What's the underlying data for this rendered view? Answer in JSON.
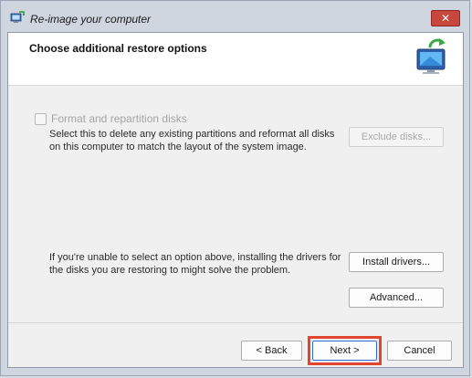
{
  "window": {
    "title": "Re-image your computer",
    "close_label": "✕"
  },
  "header": {
    "title": "Choose additional restore options",
    "icon": "computer-restore-icon"
  },
  "options": {
    "format_checkbox_label": "Format and repartition disks",
    "format_checked": false,
    "format_description": "Select this to delete any existing partitions and reformat all disks on this computer to match the layout of the system image.",
    "exclude_button": "Exclude disks...",
    "driver_description": "If you're unable to select an option above, installing the drivers for the disks you are restoring to might solve the problem.",
    "install_button": "Install drivers...",
    "advanced_button": "Advanced..."
  },
  "footer": {
    "back_button": "< Back",
    "next_button": "Next >",
    "cancel_button": "Cancel"
  },
  "colors": {
    "close_button": "#c9463d",
    "highlight": "#e0452d"
  }
}
